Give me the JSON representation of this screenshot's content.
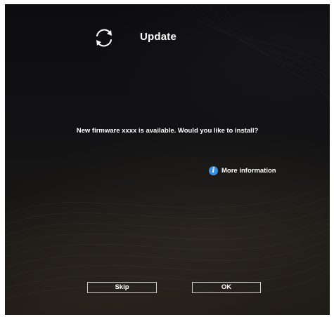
{
  "dialog": {
    "title": "Update",
    "icon": "refresh-icon",
    "message": "New firmware xxxx is available. Would you like to install?",
    "more_info": {
      "icon": "info-icon",
      "icon_glyph": "i",
      "label": "More information"
    },
    "buttons": {
      "skip_label": "Skip",
      "ok_label": "OK"
    }
  },
  "colors": {
    "text": "#ffffff",
    "info_icon": "#3b8fe0",
    "button_border": "#cfcfcf",
    "background": "#121214"
  }
}
